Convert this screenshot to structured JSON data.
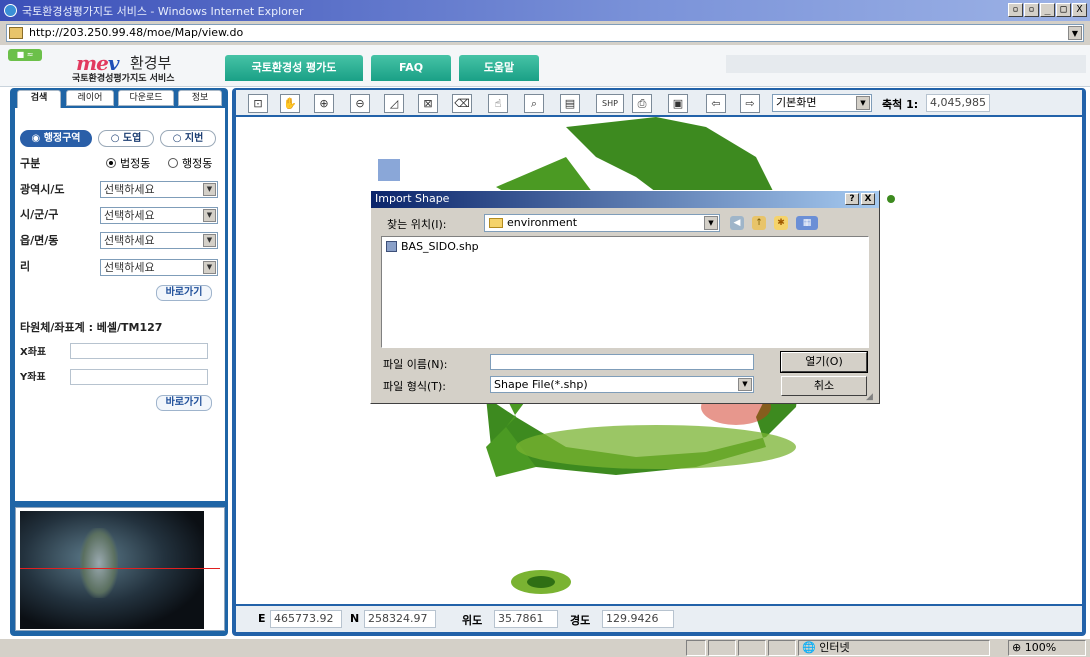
{
  "window": {
    "title": "국토환경성평가지도 서비스 - Windows Internet Explorer",
    "minimize": "_",
    "maximize": "□",
    "close": "X",
    "extra1": "▫",
    "extra2": "▫"
  },
  "address": {
    "url": "http://203.250.99.48/moe/Map/view.do"
  },
  "header": {
    "badge": "■ ≈",
    "logo_main": "me",
    "logo_accent": "v",
    "org_name": "환경부",
    "service_name": "국토환경성평가지도 서비스",
    "nav": [
      {
        "label": "국토환경성 평가도"
      },
      {
        "label": "FAQ"
      },
      {
        "label": "도움말"
      }
    ]
  },
  "left": {
    "tabs": [
      "검색",
      "레이어",
      "다운로드",
      "정보"
    ],
    "pills": [
      "행정구역",
      "도엽",
      "지번"
    ],
    "division_label": "구분",
    "division_options": [
      "법정동",
      "행정동"
    ],
    "fields": [
      {
        "label": "광역시/도",
        "value": "선택하세요"
      },
      {
        "label": "시/군/구",
        "value": "선택하세요"
      },
      {
        "label": "읍/면/동",
        "value": "선택하세요"
      },
      {
        "label": "리",
        "value": "선택하세요"
      }
    ],
    "go_label": "바로가기",
    "coord_system": "타원체/좌표계 : 베셀/TM127",
    "x_label": "X좌표",
    "y_label": "Y좌표",
    "go_label2": "바로가기"
  },
  "toolbar": {
    "icons": [
      {
        "name": "full-extent-icon",
        "glyph": "⊡"
      },
      {
        "name": "pan-hand-icon",
        "glyph": "✋"
      },
      {
        "name": "zoom-in-icon",
        "glyph": "⊕"
      },
      {
        "name": "zoom-out-icon",
        "glyph": "⊖"
      },
      {
        "name": "measure-area-icon",
        "glyph": "◿"
      },
      {
        "name": "select-box-icon",
        "glyph": "⊠"
      },
      {
        "name": "eraser-icon",
        "glyph": "⌫"
      },
      {
        "name": "identify-icon",
        "glyph": "☝"
      },
      {
        "name": "search-area-icon",
        "glyph": "⌕"
      },
      {
        "name": "document-icon",
        "glyph": "▤"
      },
      {
        "name": "shp-import-icon",
        "glyph": "SHP"
      },
      {
        "name": "print-icon",
        "glyph": "⎙"
      },
      {
        "name": "save-icon",
        "glyph": "▣"
      },
      {
        "name": "arrow-left-icon",
        "glyph": "⇦"
      },
      {
        "name": "arrow-right-icon",
        "glyph": "⇨"
      }
    ],
    "view_select": "기본화면",
    "scale_label": "축척 1:",
    "scale_value": "4,045,985"
  },
  "coords": {
    "e_label": "E",
    "e_value": "465773.92",
    "n_label": "N",
    "n_value": "258324.97",
    "lat_label": "위도",
    "lat_value": "35.7861",
    "lon_label": "경도",
    "lon_value": "129.9426"
  },
  "dialog": {
    "title": "Import Shape",
    "help": "?",
    "close": "X",
    "look_in_label": "찾는 위치(I):",
    "look_in_value": "environment",
    "files": [
      "BAS_SIDO.shp"
    ],
    "filename_label": "파일 이름(N):",
    "filename_value": "",
    "filetype_label": "파일 형식(T):",
    "filetype_value": "Shape File(*.shp)",
    "open_label": "열기(O)",
    "cancel_label": "취소"
  },
  "status": {
    "zone": "인터넷",
    "zoom": "100%"
  },
  "colors": {
    "accent": "#1f65a6",
    "nav_tab": "#1aa086",
    "title_bar": "#3b4fb8",
    "map_green": "#3d8a1f",
    "map_red": "#d0301c",
    "map_yellow": "#e8d52a"
  }
}
